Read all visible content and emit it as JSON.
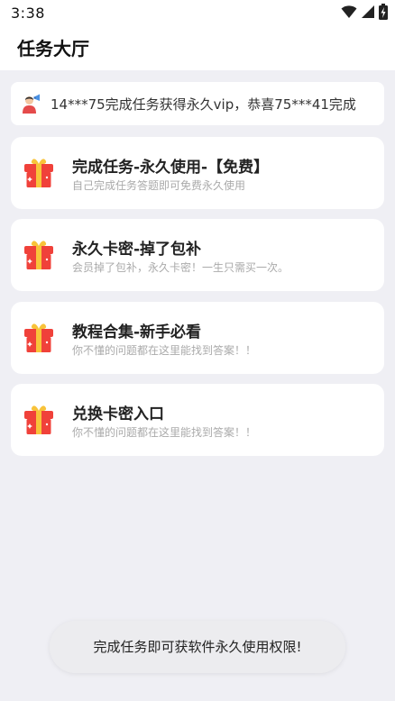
{
  "status_bar": {
    "time": "3:38",
    "icons": [
      "wifi-icon",
      "signal-icon",
      "battery-charging-icon"
    ]
  },
  "header": {
    "title": "任务大厅"
  },
  "notice": {
    "icon": "user-megaphone-icon",
    "text": "14***75完成任务获得永久vip，恭喜75***41完成"
  },
  "tasks": [
    {
      "icon": "gift-box-icon",
      "title": "完成任务-永久使用-【免费】",
      "description": "自己完成任务答题即可免费永久使用"
    },
    {
      "icon": "gift-box-icon",
      "title": "永久卡密-掉了包补",
      "description": "会员掉了包补，永久卡密！一生只需买一次。"
    },
    {
      "icon": "gift-box-icon",
      "title": "教程合集-新手必看",
      "description": "你不懂的问题都在这里能找到答案！！"
    },
    {
      "icon": "gift-box-icon",
      "title": "兑换卡密入口",
      "description": "你不懂的问题都在这里能找到答案！！"
    }
  ],
  "toast": {
    "text": "完成任务即可获软件永久使用权限!"
  },
  "colors": {
    "page_background": "#efeff4",
    "card_background": "#ffffff",
    "gift_red": "#f0413a",
    "gift_gold": "#f8c33a"
  }
}
